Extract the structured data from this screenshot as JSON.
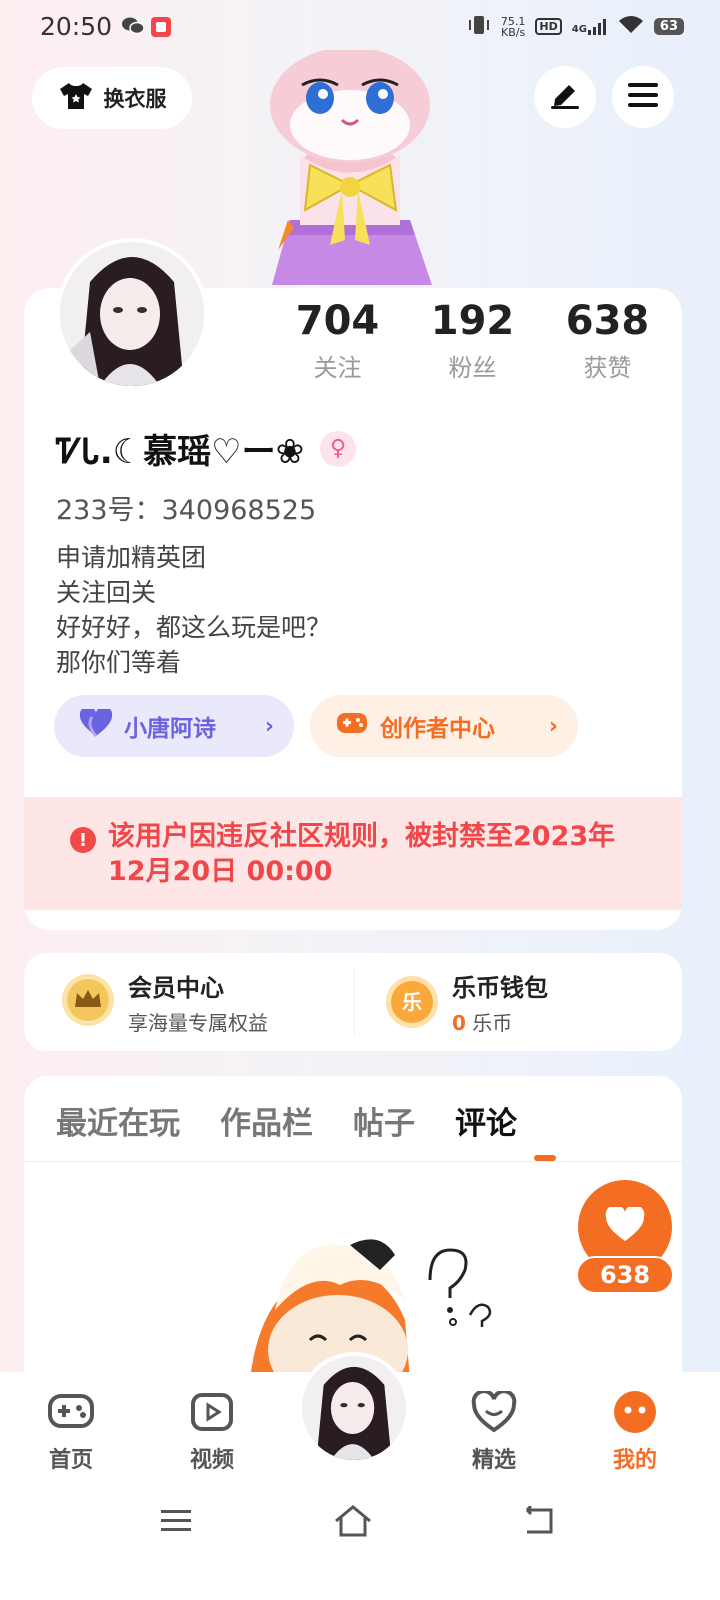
{
  "status_bar": {
    "time": "20:50",
    "net_speed_value": "75.1",
    "net_speed_unit": "KB/s",
    "hd_label": "HD",
    "signal_label": "4G",
    "battery": "63"
  },
  "header": {
    "outfit_label": "换衣服",
    "edit_icon": "pen-icon",
    "menu_icon": "menu-icon"
  },
  "profile": {
    "stats": [
      {
        "value": "704",
        "label": "关注"
      },
      {
        "value": "192",
        "label": "粉丝"
      },
      {
        "value": "638",
        "label": "获赞"
      }
    ],
    "nickname": "ᏤᏓ.☾慕瑶♡ー❀",
    "gender_symbol": "♀",
    "user_id": "233号：340968525",
    "bio": [
      "申请加精英团",
      "关注回关",
      "好好好，都这么玩是吧？",
      "那你们等着"
    ],
    "pills": [
      {
        "label": "小唐阿诗",
        "icon": "heart-icon"
      },
      {
        "label": "创作者中心",
        "icon": "gamepad-icon"
      }
    ],
    "ban_notice": "该用户因违反社区规则，被封禁至2023年12月20日 00:00"
  },
  "vip": {
    "member_title": "会员中心",
    "member_sub": "享海量专属权益",
    "wallet_title": "乐币钱包",
    "wallet_amount": "0",
    "wallet_unit": " 乐币",
    "coin_glyph": "乐"
  },
  "tabs": {
    "items": [
      "最近在玩",
      "作品栏",
      "帖子",
      "评论"
    ],
    "active_index": 3
  },
  "like_badge": {
    "count": "638"
  },
  "bottom_nav": {
    "items": [
      {
        "label": "首页"
      },
      {
        "label": "视频"
      },
      {
        "label": "精选"
      },
      {
        "label": "我的"
      }
    ],
    "active_index": 3
  },
  "colors": {
    "accent": "#f36d22",
    "ban_text": "#f0484a",
    "pill_purple": "#6b63e0"
  }
}
